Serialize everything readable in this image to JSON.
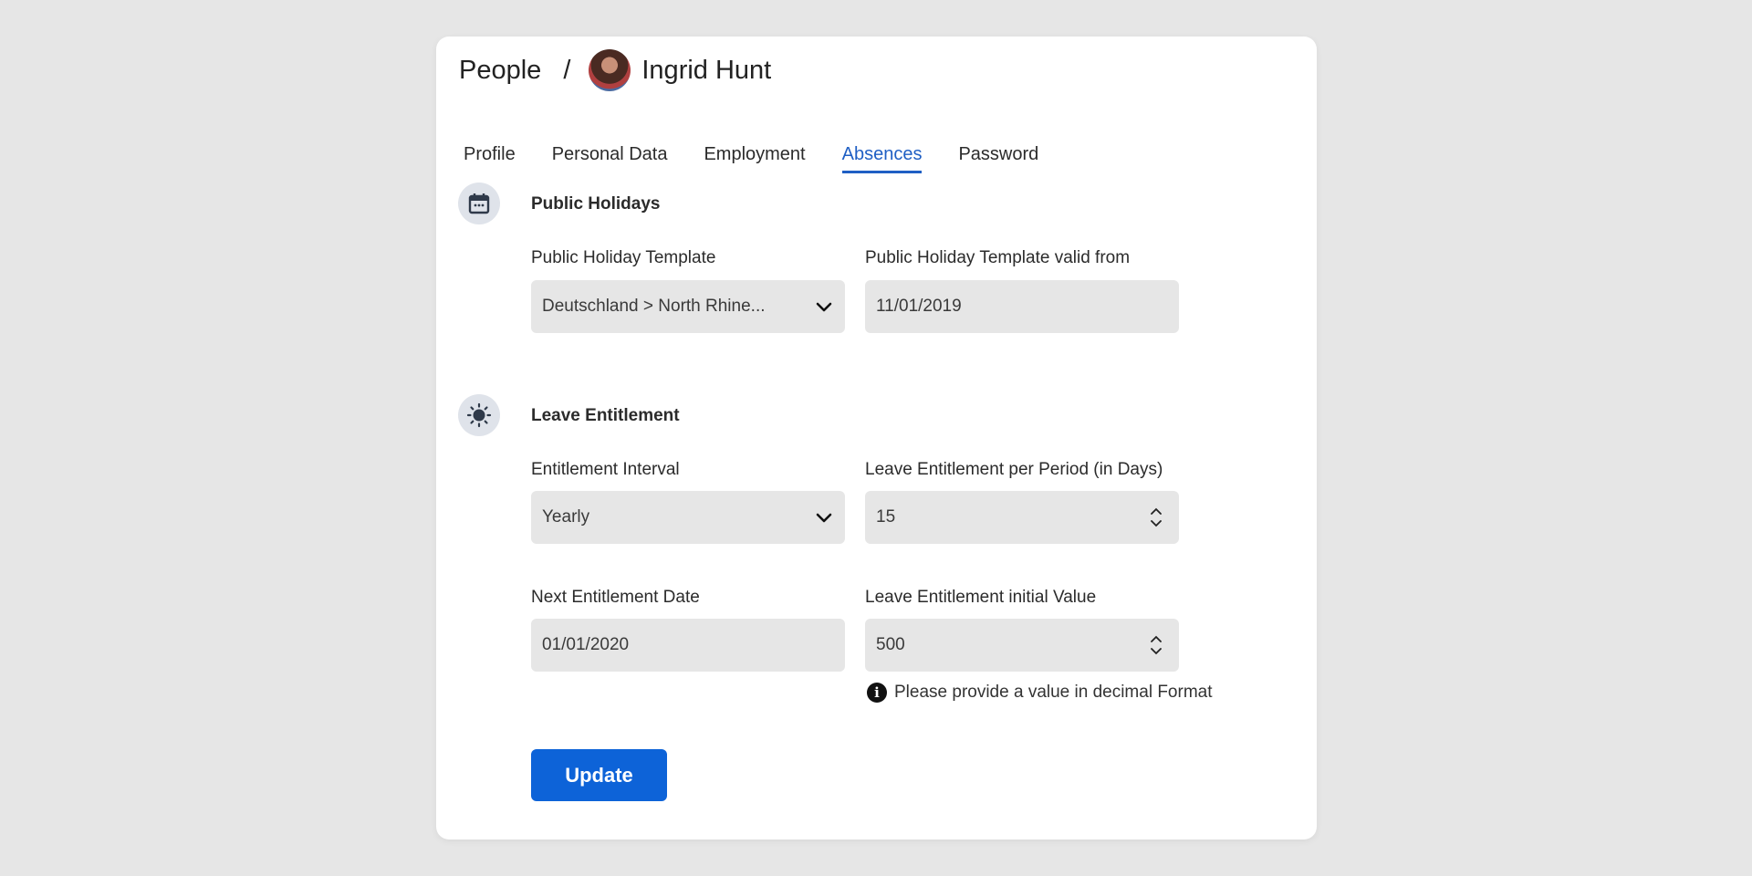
{
  "breadcrumb": {
    "root": "People",
    "separator": "/",
    "person": "Ingrid Hunt"
  },
  "tabs": [
    {
      "label": "Profile"
    },
    {
      "label": "Personal Data"
    },
    {
      "label": "Employment"
    },
    {
      "label": "Absences",
      "active": true
    },
    {
      "label": "Password"
    }
  ],
  "public_holidays": {
    "title": "Public Holidays",
    "icon": "calendar-icon",
    "template_label": "Public Holiday Template",
    "template_value": "Deutschland > North Rhine...",
    "valid_from_label": "Public Holiday Template valid from",
    "valid_from_value": "11/01/2019"
  },
  "leave_entitlement": {
    "title": "Leave Entitlement",
    "icon": "sun-icon",
    "interval_label": "Entitlement Interval",
    "interval_value": "Yearly",
    "per_period_label": "Leave Entitlement per Period (in Days)",
    "per_period_value": "15",
    "next_date_label": "Next Entitlement Date",
    "next_date_value": "01/01/2020",
    "initial_label": "Leave Entitlement initial Value",
    "initial_value": "500",
    "hint": "Please provide a value in decimal Format"
  },
  "actions": {
    "update_label": "Update"
  },
  "colors": {
    "accent": "#0d63d8",
    "tab_active": "#1f5fc4",
    "background": "#e6e6e6"
  }
}
